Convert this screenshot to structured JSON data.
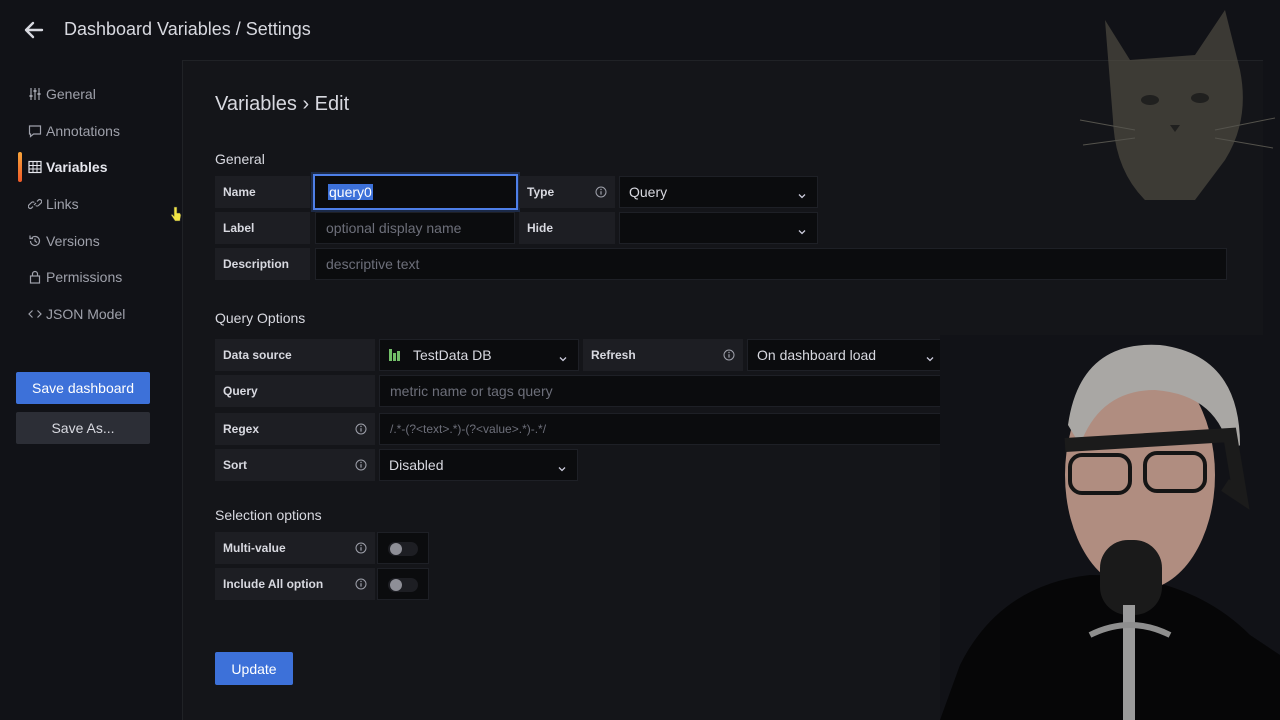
{
  "header": {
    "title": "Dashboard Variables / Settings"
  },
  "sidebar": {
    "items": [
      {
        "label": "General",
        "icon": "sliders-icon",
        "active": false
      },
      {
        "label": "Annotations",
        "icon": "comment-icon",
        "active": false
      },
      {
        "label": "Variables",
        "icon": "table-icon",
        "active": true
      },
      {
        "label": "Links",
        "icon": "link-icon",
        "active": false
      },
      {
        "label": "Versions",
        "icon": "history-icon",
        "active": false
      },
      {
        "label": "Permissions",
        "icon": "lock-icon",
        "active": false
      },
      {
        "label": "JSON Model",
        "icon": "code-icon",
        "active": false
      }
    ],
    "save_label": "Save dashboard",
    "save_as_label": "Save As..."
  },
  "main": {
    "heading": "Variables › Edit",
    "general": {
      "title": "General",
      "name_label": "Name",
      "name_value": "query0",
      "type_label": "Type",
      "type_value": "Query",
      "label_label": "Label",
      "label_placeholder": "optional display name",
      "hide_label": "Hide",
      "hide_value": "",
      "description_label": "Description",
      "description_placeholder": "descriptive text"
    },
    "query_options": {
      "title": "Query Options",
      "datasource_label": "Data source",
      "datasource_value": "TestData DB",
      "refresh_label": "Refresh",
      "refresh_value": "On dashboard load",
      "query_label": "Query",
      "query_placeholder": "metric name or tags query",
      "regex_label": "Regex",
      "regex_placeholder": "/.*-(?<text>.*)-(?<value>.*)-.*/",
      "sort_label": "Sort",
      "sort_value": "Disabled"
    },
    "selection_options": {
      "title": "Selection options",
      "multi_value_label": "Multi-value",
      "multi_value": false,
      "include_all_label": "Include All option",
      "include_all": false
    },
    "update_label": "Update"
  },
  "colors": {
    "background": "#111217",
    "panel": "#141519",
    "primary": "#3d71d9",
    "active_accent": "#f05a28",
    "datasource_icon": "#73bf69"
  }
}
